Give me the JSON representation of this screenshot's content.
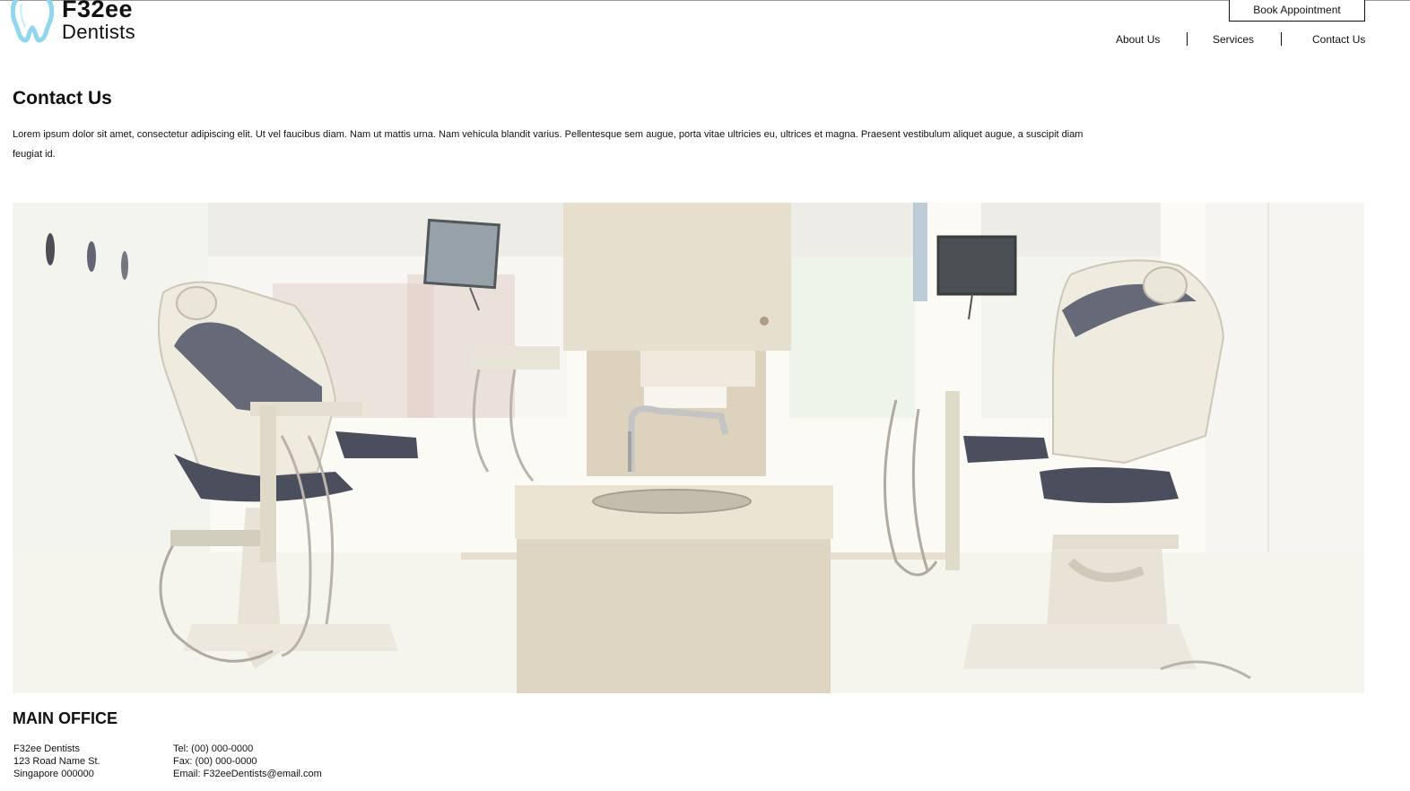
{
  "brand": {
    "name": "F32ee",
    "subtitle": "Dentists",
    "logo_color": "#8fd6ee"
  },
  "header": {
    "book_button": "Book Appointment",
    "nav": [
      "About Us",
      "Services",
      "Contact Us"
    ]
  },
  "page": {
    "title": "Contact Us",
    "intro": "Lorem ipsum dolor sit amet, consectetur adipiscing elit. Ut vel faucibus diam. Nam ut mattis urna. Nam vehicula blandit varius. Pellentesque sem augue, porta vitae ultricies eu, ultrices et magna. Praesent vestibulum aliquet augue, a suscipit diam feugiat id."
  },
  "hero": {
    "icon": "dental-clinic-photo"
  },
  "office": {
    "title": "MAIN OFFICE",
    "address": [
      "F32ee Dentists",
      "123 Road Name St.",
      "Singapore 000000"
    ],
    "contact": [
      "Tel: (00) 000-0000",
      "Fax: (00) 000-0000",
      "Email: F32eeDentists@email.com"
    ]
  }
}
